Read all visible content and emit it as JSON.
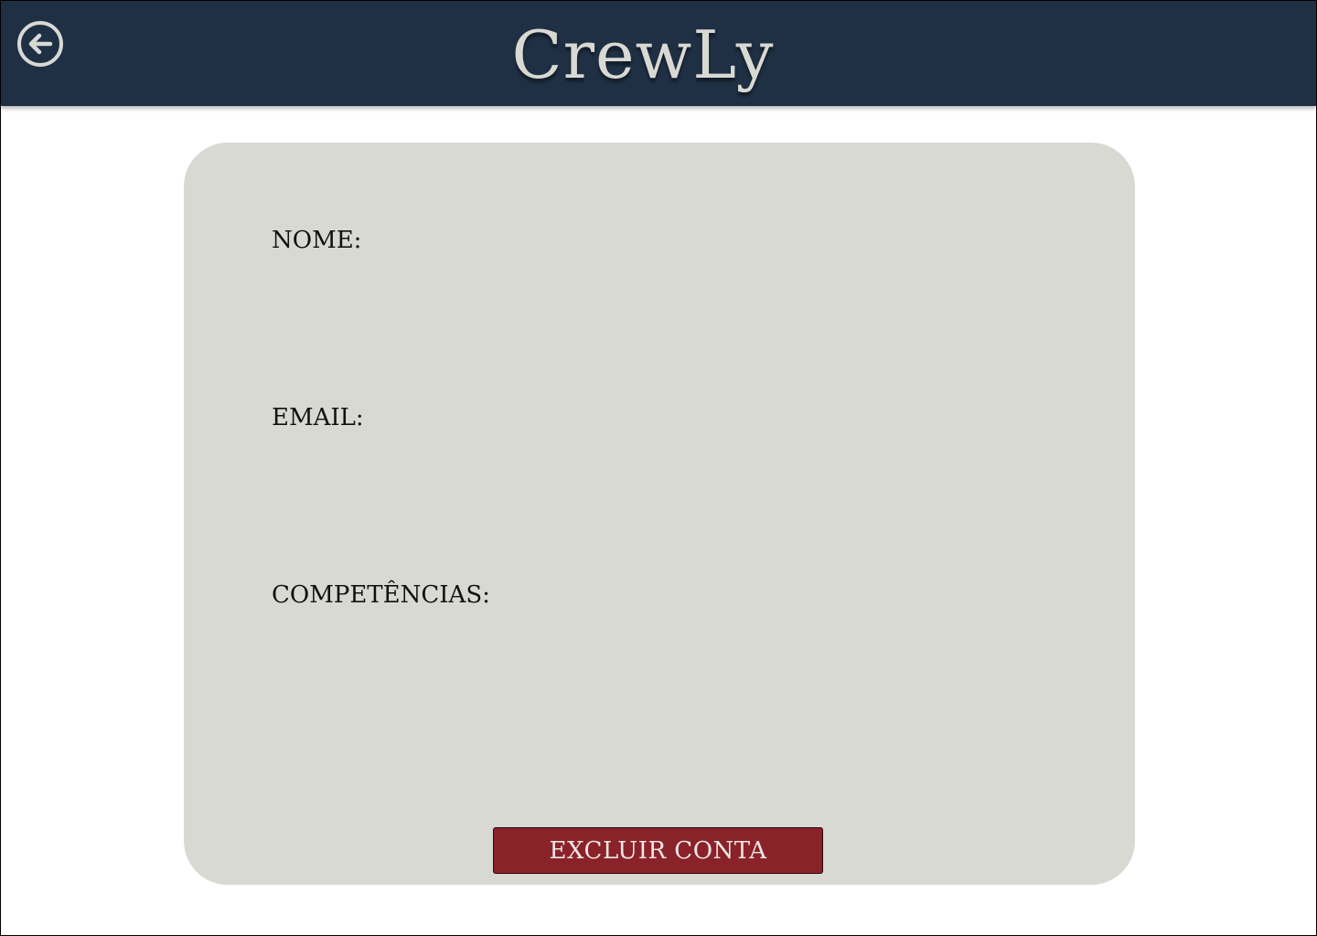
{
  "header": {
    "title": "CrewLy",
    "back_icon": "back-arrow-circle-icon",
    "background_color": "#1f3044",
    "title_color": "#d9d9d4"
  },
  "profile_card": {
    "background_color": "#d9d9d3",
    "fields": {
      "name_label": "NOME:",
      "email_label": "EMAIL:",
      "skills_label": "COMPETÊNCIAS:"
    },
    "delete_button": {
      "label": "EXCLUIR CONTA",
      "color": "#8a2229"
    }
  }
}
